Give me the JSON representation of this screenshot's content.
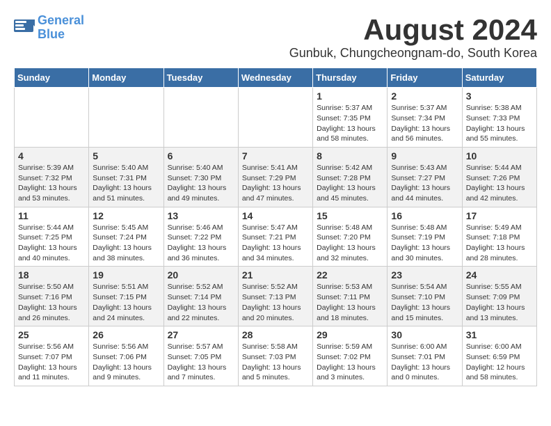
{
  "logo": {
    "line1": "General",
    "line2": "Blue"
  },
  "title": "August 2024",
  "location": "Gunbuk, Chungcheongnam-do, South Korea",
  "weekdays": [
    "Sunday",
    "Monday",
    "Tuesday",
    "Wednesday",
    "Thursday",
    "Friday",
    "Saturday"
  ],
  "weeks": [
    [
      {
        "day": "",
        "info": ""
      },
      {
        "day": "",
        "info": ""
      },
      {
        "day": "",
        "info": ""
      },
      {
        "day": "",
        "info": ""
      },
      {
        "day": "1",
        "info": "Sunrise: 5:37 AM\nSunset: 7:35 PM\nDaylight: 13 hours\nand 58 minutes."
      },
      {
        "day": "2",
        "info": "Sunrise: 5:37 AM\nSunset: 7:34 PM\nDaylight: 13 hours\nand 56 minutes."
      },
      {
        "day": "3",
        "info": "Sunrise: 5:38 AM\nSunset: 7:33 PM\nDaylight: 13 hours\nand 55 minutes."
      }
    ],
    [
      {
        "day": "4",
        "info": "Sunrise: 5:39 AM\nSunset: 7:32 PM\nDaylight: 13 hours\nand 53 minutes."
      },
      {
        "day": "5",
        "info": "Sunrise: 5:40 AM\nSunset: 7:31 PM\nDaylight: 13 hours\nand 51 minutes."
      },
      {
        "day": "6",
        "info": "Sunrise: 5:40 AM\nSunset: 7:30 PM\nDaylight: 13 hours\nand 49 minutes."
      },
      {
        "day": "7",
        "info": "Sunrise: 5:41 AM\nSunset: 7:29 PM\nDaylight: 13 hours\nand 47 minutes."
      },
      {
        "day": "8",
        "info": "Sunrise: 5:42 AM\nSunset: 7:28 PM\nDaylight: 13 hours\nand 45 minutes."
      },
      {
        "day": "9",
        "info": "Sunrise: 5:43 AM\nSunset: 7:27 PM\nDaylight: 13 hours\nand 44 minutes."
      },
      {
        "day": "10",
        "info": "Sunrise: 5:44 AM\nSunset: 7:26 PM\nDaylight: 13 hours\nand 42 minutes."
      }
    ],
    [
      {
        "day": "11",
        "info": "Sunrise: 5:44 AM\nSunset: 7:25 PM\nDaylight: 13 hours\nand 40 minutes."
      },
      {
        "day": "12",
        "info": "Sunrise: 5:45 AM\nSunset: 7:24 PM\nDaylight: 13 hours\nand 38 minutes."
      },
      {
        "day": "13",
        "info": "Sunrise: 5:46 AM\nSunset: 7:22 PM\nDaylight: 13 hours\nand 36 minutes."
      },
      {
        "day": "14",
        "info": "Sunrise: 5:47 AM\nSunset: 7:21 PM\nDaylight: 13 hours\nand 34 minutes."
      },
      {
        "day": "15",
        "info": "Sunrise: 5:48 AM\nSunset: 7:20 PM\nDaylight: 13 hours\nand 32 minutes."
      },
      {
        "day": "16",
        "info": "Sunrise: 5:48 AM\nSunset: 7:19 PM\nDaylight: 13 hours\nand 30 minutes."
      },
      {
        "day": "17",
        "info": "Sunrise: 5:49 AM\nSunset: 7:18 PM\nDaylight: 13 hours\nand 28 minutes."
      }
    ],
    [
      {
        "day": "18",
        "info": "Sunrise: 5:50 AM\nSunset: 7:16 PM\nDaylight: 13 hours\nand 26 minutes."
      },
      {
        "day": "19",
        "info": "Sunrise: 5:51 AM\nSunset: 7:15 PM\nDaylight: 13 hours\nand 24 minutes."
      },
      {
        "day": "20",
        "info": "Sunrise: 5:52 AM\nSunset: 7:14 PM\nDaylight: 13 hours\nand 22 minutes."
      },
      {
        "day": "21",
        "info": "Sunrise: 5:52 AM\nSunset: 7:13 PM\nDaylight: 13 hours\nand 20 minutes."
      },
      {
        "day": "22",
        "info": "Sunrise: 5:53 AM\nSunset: 7:11 PM\nDaylight: 13 hours\nand 18 minutes."
      },
      {
        "day": "23",
        "info": "Sunrise: 5:54 AM\nSunset: 7:10 PM\nDaylight: 13 hours\nand 15 minutes."
      },
      {
        "day": "24",
        "info": "Sunrise: 5:55 AM\nSunset: 7:09 PM\nDaylight: 13 hours\nand 13 minutes."
      }
    ],
    [
      {
        "day": "25",
        "info": "Sunrise: 5:56 AM\nSunset: 7:07 PM\nDaylight: 13 hours\nand 11 minutes."
      },
      {
        "day": "26",
        "info": "Sunrise: 5:56 AM\nSunset: 7:06 PM\nDaylight: 13 hours\nand 9 minutes."
      },
      {
        "day": "27",
        "info": "Sunrise: 5:57 AM\nSunset: 7:05 PM\nDaylight: 13 hours\nand 7 minutes."
      },
      {
        "day": "28",
        "info": "Sunrise: 5:58 AM\nSunset: 7:03 PM\nDaylight: 13 hours\nand 5 minutes."
      },
      {
        "day": "29",
        "info": "Sunrise: 5:59 AM\nSunset: 7:02 PM\nDaylight: 13 hours\nand 3 minutes."
      },
      {
        "day": "30",
        "info": "Sunrise: 6:00 AM\nSunset: 7:01 PM\nDaylight: 13 hours\nand 0 minutes."
      },
      {
        "day": "31",
        "info": "Sunrise: 6:00 AM\nSunset: 6:59 PM\nDaylight: 12 hours\nand 58 minutes."
      }
    ]
  ]
}
